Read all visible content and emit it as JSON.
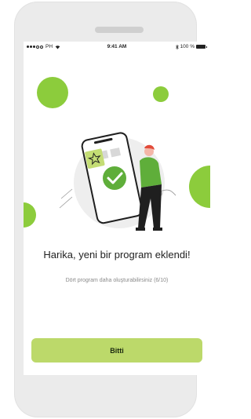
{
  "status_bar": {
    "carrier": "PH",
    "time": "9:41 AM",
    "battery": "100 %"
  },
  "content": {
    "title": "Harika, yeni bir program eklendi!",
    "subtitle": "Dört program daha oluşturabilirsiniz (6/10)"
  },
  "actions": {
    "done_label": "Bitti"
  },
  "colors": {
    "accent_green": "#8ccc3c",
    "button_green": "#bcd96a",
    "device_frame": "#ebebeb"
  }
}
